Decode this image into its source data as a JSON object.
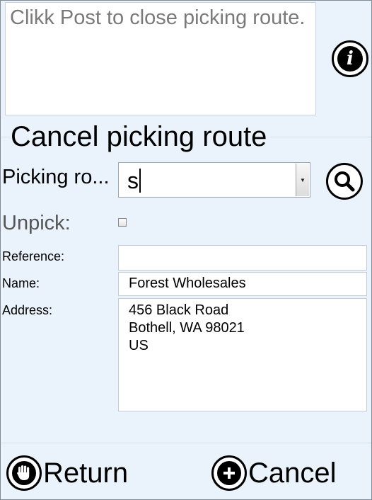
{
  "message": {
    "text": "Clikk Post to close picking route."
  },
  "title": "Cancel picking route",
  "picking_route": {
    "label": "Picking ro...",
    "value": "s"
  },
  "unpick": {
    "label": "Unpick:",
    "checked": false
  },
  "reference": {
    "label": "Reference:",
    "value": ""
  },
  "name": {
    "label": "Name:",
    "value": "Forest Wholesales"
  },
  "address": {
    "label": "Address:",
    "lines": [
      "456 Black Road",
      "Bothell, WA 98021",
      "US"
    ]
  },
  "buttons": {
    "return_label": "Return",
    "cancel_label": "Cancel"
  },
  "icons": {
    "info": "info-icon",
    "lookup": "magnifier-icon",
    "return": "hand-stop-icon",
    "cancel": "plus-circle-icon",
    "dropdown": "triangle-down-icon"
  }
}
